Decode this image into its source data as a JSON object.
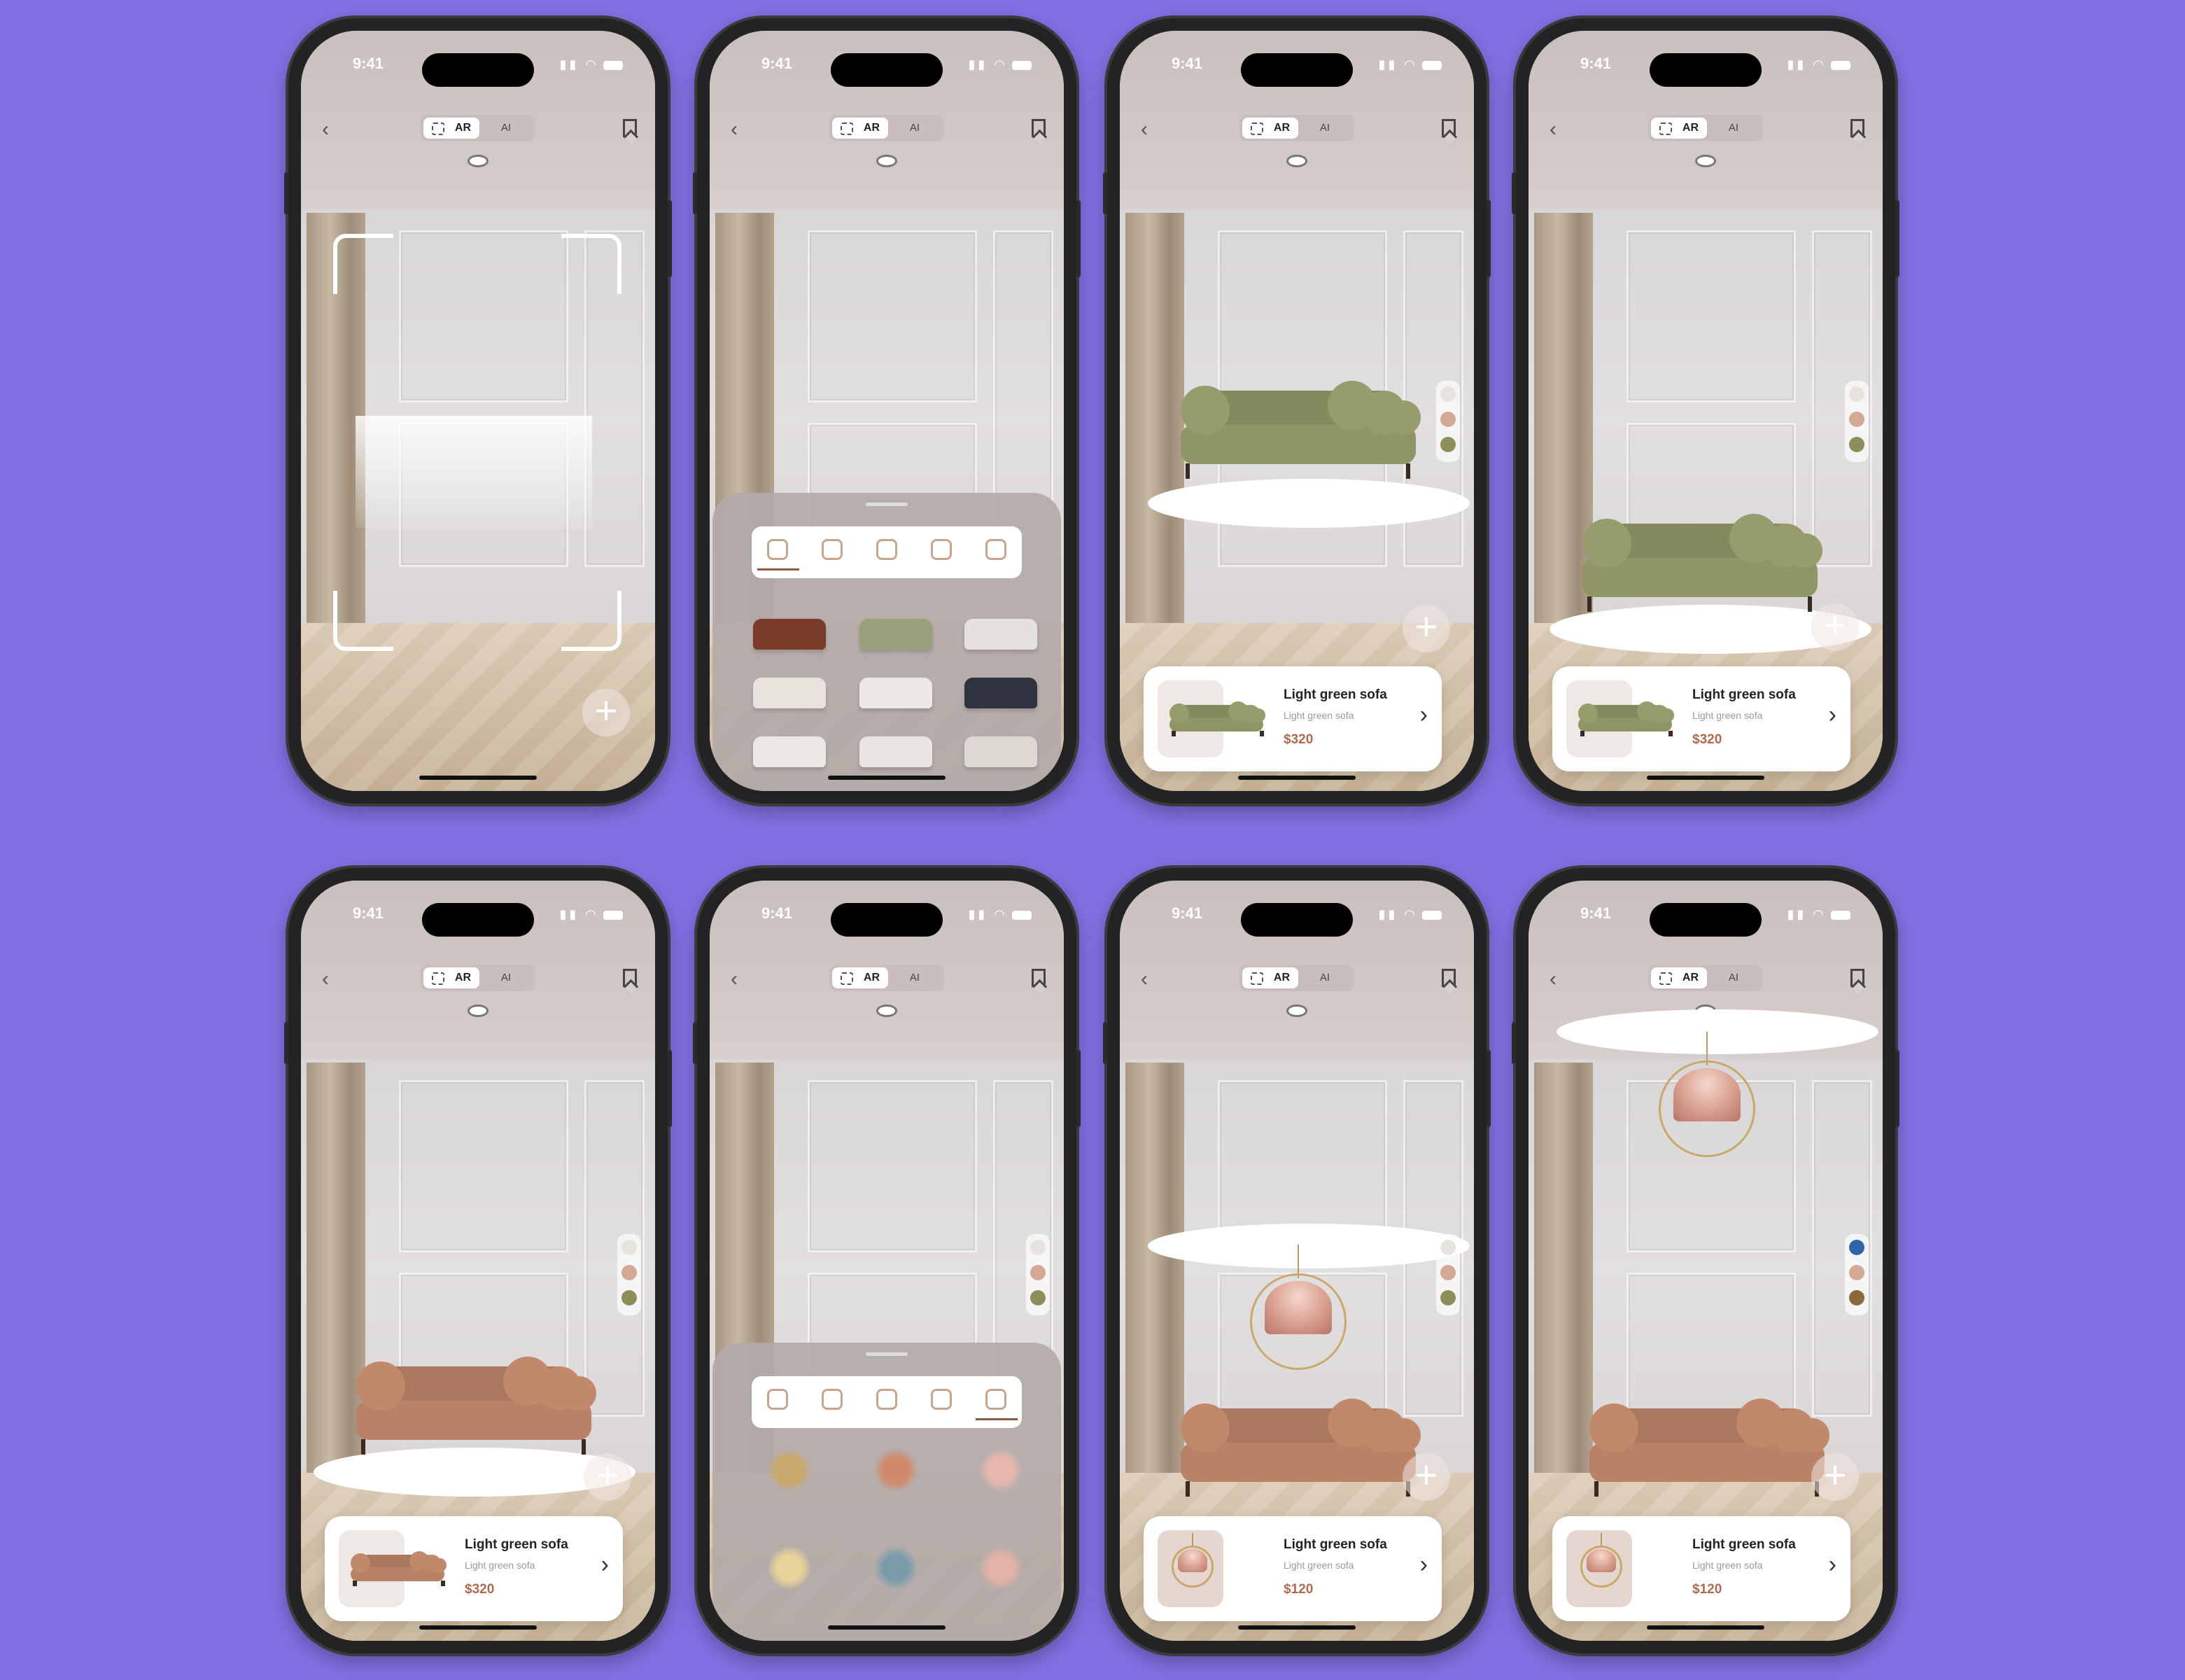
{
  "status": {
    "time": "9:41"
  },
  "topbar": {
    "ar_label": "AR",
    "ai_label": "AI"
  },
  "product_sofa": {
    "name": "Light green sofa",
    "subtitle": "Light green sofa",
    "price": "$320"
  },
  "product_lamp": {
    "name": "Light green sofa",
    "subtitle": "Light green sofa",
    "price": "$120"
  },
  "icons": {
    "back": "chevron-left-icon",
    "bookmark": "bookmark-icon",
    "add": "plus-icon",
    "next": "chevron-right-icon",
    "ar_mode": "ar-scan-icon"
  },
  "categories": [
    "sofa-icon",
    "image-icon",
    "chair-icon",
    "paint-roller-icon",
    "lamp-icon"
  ],
  "colors": {
    "background": "#8470e4",
    "price": "#b06a52",
    "sofa_green": "#8f9566",
    "sofa_terracotta": "#b98266",
    "swatch_light": "#e6e4dc",
    "swatch_pink": "#d3a894",
    "swatch_olive": "#8d8f5b",
    "swatch_blue": "#2f64a8",
    "swatch_brown": "#8a6a3a"
  }
}
